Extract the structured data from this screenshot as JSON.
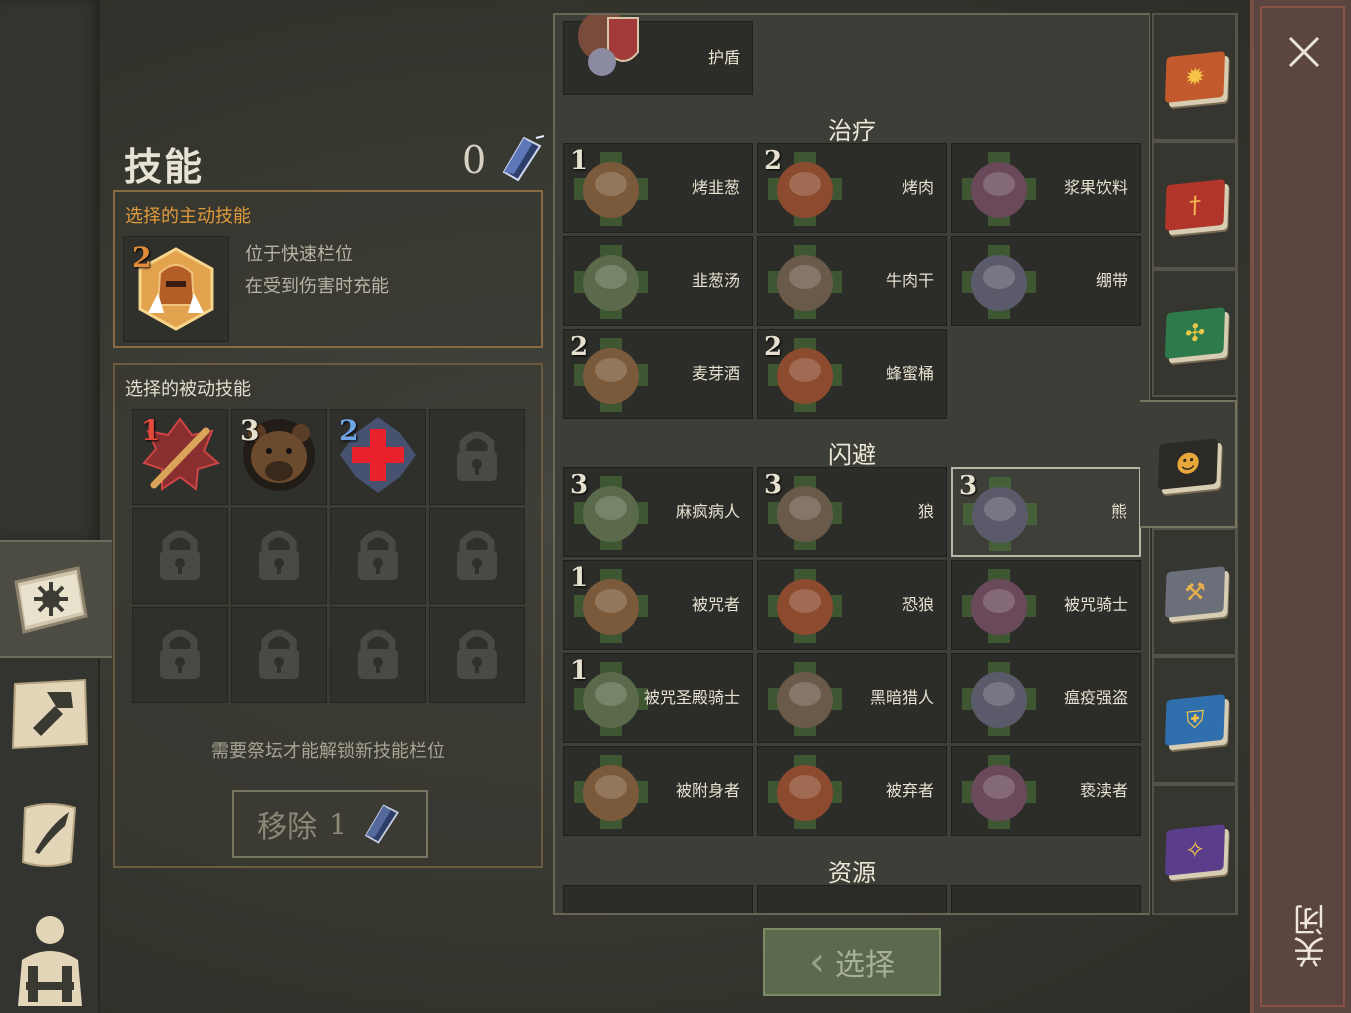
{
  "skills": {
    "title": "技能",
    "crystal_count": "0",
    "active": {
      "header": "选择的主动技能",
      "level": "2",
      "desc_line1": "位于快速栏位",
      "desc_line2": "在受到伤害时充能"
    },
    "passive": {
      "header": "选择的被动技能",
      "slots": [
        {
          "level": "1",
          "icon": "spiked-club-icon"
        },
        {
          "level": "3",
          "icon": "bear-head-icon"
        },
        {
          "level": "2",
          "icon": "red-cross-icon"
        }
      ],
      "locked_count": 9
    },
    "unlock_hint": "需要祭坛才能解锁新技能栏位",
    "remove_label": "移除",
    "remove_cost": "1"
  },
  "list": {
    "top_item": {
      "label": "护盾",
      "icon": "shield-icon"
    },
    "sections": [
      {
        "title": "治疗",
        "items": [
          {
            "label": "烤韭葱",
            "level": "1",
            "icon": "grilled-leek-icon"
          },
          {
            "label": "烤肉",
            "level": "2",
            "icon": "roast-meat-icon"
          },
          {
            "label": "浆果饮料",
            "level": "",
            "icon": "berry-drink-icon"
          },
          {
            "label": "韭葱汤",
            "level": "",
            "icon": "leek-soup-icon"
          },
          {
            "label": "牛肉干",
            "level": "",
            "icon": "jerky-icon"
          },
          {
            "label": "绷带",
            "level": "",
            "icon": "bandage-icon"
          },
          {
            "label": "麦芽酒",
            "level": "2",
            "icon": "ale-mug-icon"
          },
          {
            "label": "蜂蜜桶",
            "level": "2",
            "icon": "honey-barrel-icon"
          }
        ]
      },
      {
        "title": "闪避",
        "items": [
          {
            "label": "麻疯病人",
            "level": "3",
            "icon": "leper-icon"
          },
          {
            "label": "狼",
            "level": "3",
            "icon": "wolf-icon"
          },
          {
            "label": "熊",
            "level": "3",
            "icon": "bear-icon",
            "selected": true
          },
          {
            "label": "被咒者",
            "level": "1",
            "icon": "cursed-icon"
          },
          {
            "label": "恐狼",
            "level": "",
            "icon": "dire-wolf-icon"
          },
          {
            "label": "被咒骑士",
            "level": "",
            "icon": "cursed-knight-icon"
          },
          {
            "label": "被咒圣殿骑士",
            "level": "1",
            "icon": "cursed-templar-icon"
          },
          {
            "label": "黑暗猎人",
            "level": "",
            "icon": "dark-hunter-icon"
          },
          {
            "label": "瘟疫强盗",
            "level": "",
            "icon": "plague-bandit-icon"
          },
          {
            "label": "被附身者",
            "level": "",
            "icon": "possessed-icon"
          },
          {
            "label": "被弃者",
            "level": "",
            "icon": "forsaken-icon"
          },
          {
            "label": "亵渎者",
            "level": "",
            "icon": "desecrator-icon"
          }
        ]
      },
      {
        "title": "资源",
        "items": []
      }
    ]
  },
  "select_button": "选择",
  "close_label": "关闭",
  "colors": {
    "accent_orange": "#e09a3c",
    "gold_border": "#6b5a3e",
    "locked": "#4a4a44"
  }
}
